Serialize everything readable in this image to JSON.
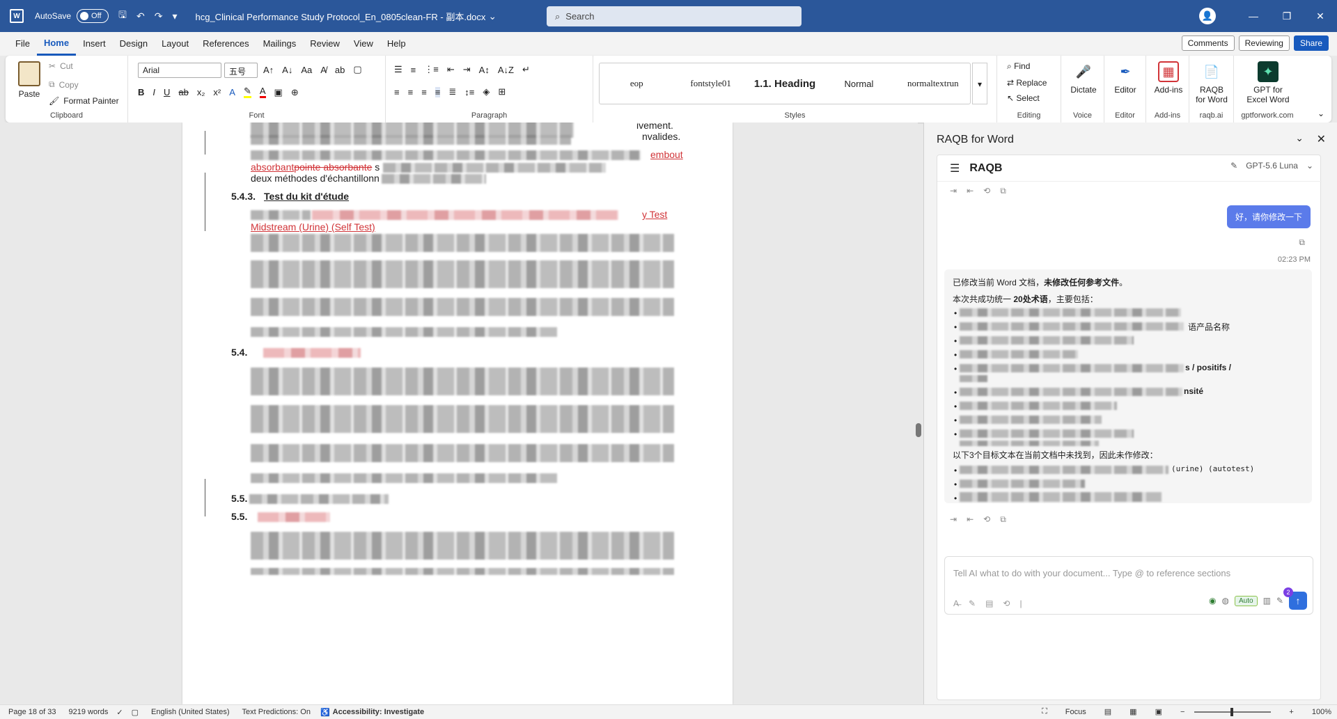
{
  "titlebar": {
    "autosave_label": "AutoSave",
    "autosave_state": "Off",
    "doc_title": "hcg_Clinical Performance Study Protocol_En_0805clean-FR - 副本.docx",
    "search_placeholder": "Search"
  },
  "tabs": [
    "File",
    "Home",
    "Insert",
    "Design",
    "Layout",
    "References",
    "Mailings",
    "Review",
    "View",
    "Help"
  ],
  "tab_actions": {
    "comments": "Comments",
    "reviewing": "Reviewing",
    "share": "Share"
  },
  "ribbon": {
    "clipboard": {
      "paste": "Paste",
      "cut": "Cut",
      "copy": "Copy",
      "format_painter": "Format Painter",
      "label": "Clipboard"
    },
    "font": {
      "family": "Arial",
      "size": "五号",
      "label": "Font"
    },
    "paragraph": {
      "label": "Paragraph"
    },
    "styles": {
      "items": [
        "eop",
        "fontstyle01",
        "1.1.  Heading",
        "Normal",
        "normaltextrun"
      ],
      "label": "Styles"
    },
    "editing": {
      "find": "Find",
      "replace": "Replace",
      "select": "Select",
      "label": "Editing"
    },
    "voice": {
      "dictate": "Dictate",
      "label": "Voice"
    },
    "editor": {
      "editor": "Editor",
      "label": "Editor"
    },
    "addins": {
      "addins": "Add-ins",
      "label": "Add-ins"
    },
    "raqb": {
      "name": "RAQB for Word",
      "label": "raqb.ai"
    },
    "gpt": {
      "name": "GPT for Excel Word",
      "label": "gptforwork.com"
    }
  },
  "document": {
    "line1_tail": "ivement.",
    "line2_tail": "nvalides.",
    "embout": "embout",
    "absorbant": "absorbant",
    "pointe_absorbante": "pointe absorbante",
    "s_char": "s",
    "deux_methodes": "deux méthodes d'échantillonn",
    "h543_num": "5.4.3.",
    "h543_title": "Test du kit d'étude",
    "self_test_tail": "y Test",
    "midstream": "Midstream  (Urine)  (Self Test)",
    "h544": "5.4.",
    "h55": "5.5.",
    "h551": "5.5.",
    "bottom_text": "personne l'on la rapport pretence est d'une question qui tourner"
  },
  "pane": {
    "title": "RAQB for Word",
    "app_name": "RAQB",
    "model": "GPT-5.6 Luna",
    "user_message": "好，请你修改一下",
    "time": "02:23 PM",
    "ai_line1_a": "已修改当前 Word 文档，",
    "ai_line1_b": "未修改任何参考文件",
    "ai_line1_c": "。",
    "ai_line2_a": "本次共成功统一 ",
    "ai_line2_b": "20处术语",
    "ai_line2_c": "，主要包括：",
    "b2_tail": "语产品名称",
    "b5_tail": "s / positifs /",
    "b6_tail": "nsité",
    "ai_line3": "以下3个目标文本在当前文档中未找到，因此未作修改：",
    "c1_tail": "(urine) (autotest)",
    "input_placeholder": "Tell AI what to do with your document... Type @ to reference sections",
    "auto": "Auto",
    "badge": "2"
  },
  "status": {
    "page": "Page 18 of 33",
    "words": "9219 words",
    "language": "English (United States)",
    "predictions": "Text Predictions: On",
    "accessibility": "Accessibility: Investigate",
    "focus": "Focus",
    "zoom": "100%"
  },
  "colors": {
    "titlebar": "#2b579a",
    "accent": "#185abd",
    "revision_red": "#d13438",
    "send_button": "#2f6fde"
  }
}
